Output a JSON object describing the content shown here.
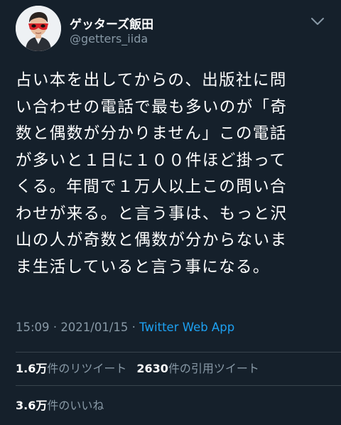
{
  "author": {
    "display_name": "ゲッターズ飯田",
    "handle": "@getters_iida",
    "avatar_icon": "avatar-icon",
    "more_icon": "chevron-down-icon"
  },
  "tweet": {
    "lines": [
      "占い本を出してからの、出版社に問",
      "い合わせの電話で最も多いのが「奇",
      "数と偶数が分かりません」この電話",
      "が多いと１日に１００件ほど掛って",
      "くる。年間で１万人以上この問い合",
      "わせが来る。と言う事は、もっと沢",
      "山の人が奇数と偶数が分からないま",
      "ま生活していると言う事になる。"
    ]
  },
  "meta": {
    "time": "15:09",
    "separator1": "·",
    "date": "2021/01/15",
    "separator2": "·",
    "source": "Twitter Web App"
  },
  "stats": {
    "retweets_count": "1.6万",
    "retweets_label": "件のリツイート",
    "quotes_count": "2630",
    "quotes_label": "件の引用ツイート",
    "likes_count": "3.6万",
    "likes_label": "件のいいね"
  },
  "colors": {
    "background": "#15202b",
    "text": "#ffffff",
    "secondary": "#8899a6",
    "link": "#1da1f2",
    "divider": "#38444d"
  }
}
